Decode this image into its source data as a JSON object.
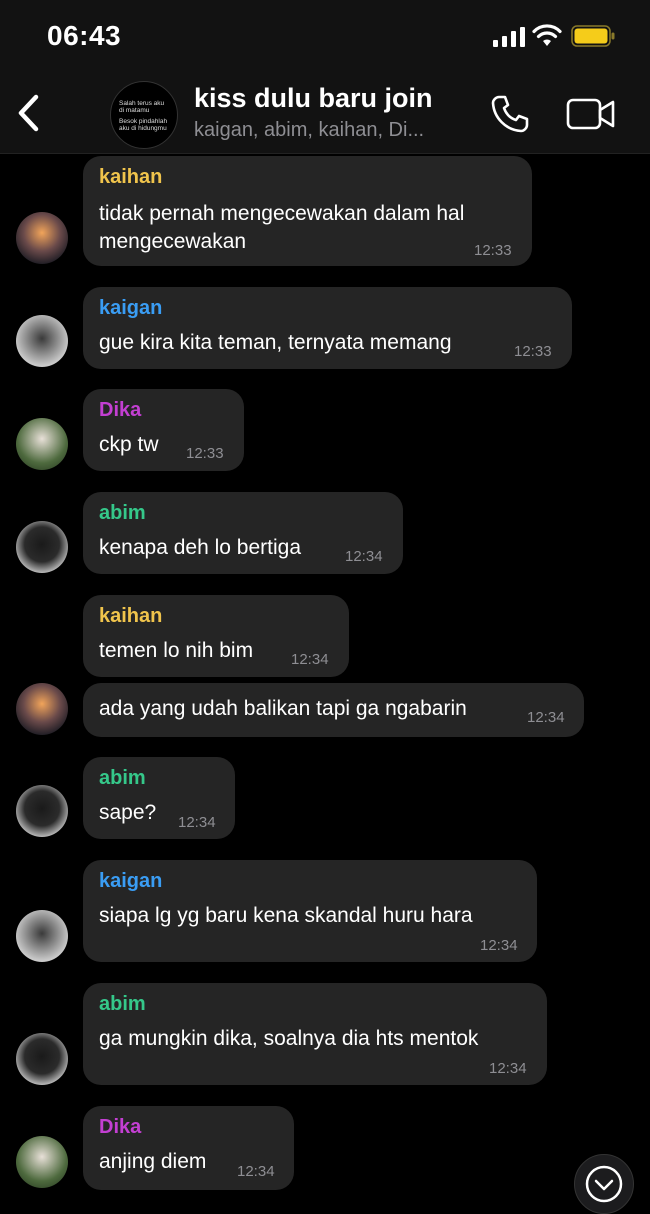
{
  "status_bar": {
    "time": "06:43"
  },
  "header": {
    "avatar_text_1": "Salah terus aku di matamu",
    "avatar_text_2": "Besok pindahlah aku di hidungmu",
    "title": "kiss dulu baru join",
    "members": "kaigan, abim, kaihan, Di..."
  },
  "colors": {
    "kaihan": "#f0c44c",
    "kaigan": "#3a9df4",
    "Dika": "#c33fd2",
    "abim": "#35c88a"
  },
  "messages": [
    {
      "sender": "kaihan",
      "lines": [
        "tidak pernah mengecewakan dalam hal",
        "mengecewakan"
      ],
      "time": "12:33"
    },
    {
      "sender": "kaigan",
      "lines": [
        "gue kira kita teman, ternyata memang"
      ],
      "time": "12:33"
    },
    {
      "sender": "Dika",
      "lines": [
        "ckp tw"
      ],
      "time": "12:33"
    },
    {
      "sender": "abim",
      "lines": [
        "kenapa deh lo bertiga"
      ],
      "time": "12:34"
    },
    {
      "sender": "kaihan",
      "lines": [
        "temen lo nih bim"
      ],
      "time": "12:34"
    },
    {
      "sender": "",
      "lines": [
        "ada yang udah balikan tapi ga ngabarin"
      ],
      "time": "12:34"
    },
    {
      "sender": "abim",
      "lines": [
        "sape?"
      ],
      "time": "12:34"
    },
    {
      "sender": "kaigan",
      "lines": [
        "siapa lg yg baru kena skandal huru hara"
      ],
      "time": "12:34"
    },
    {
      "sender": "abim",
      "lines": [
        "ga mungkin dika, soalnya dia hts mentok"
      ],
      "time": "12:34"
    },
    {
      "sender": "Dika",
      "lines": [
        "anjing diem"
      ],
      "time": "12:34"
    }
  ]
}
